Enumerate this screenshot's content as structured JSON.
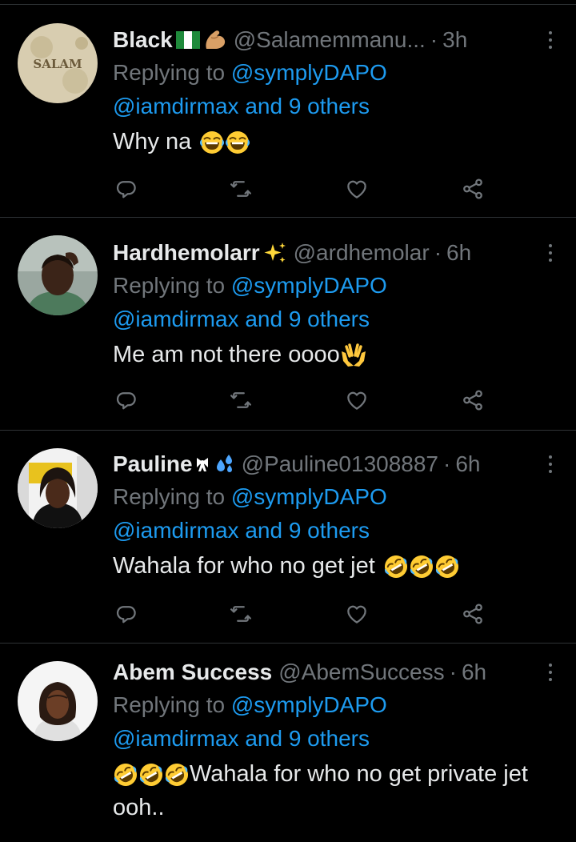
{
  "icons": {
    "more": "more-vertical-icon",
    "reply": "reply-icon",
    "retweet": "retweet-icon",
    "like": "heart-icon",
    "share": "share-icon"
  },
  "colors": {
    "background": "#000000",
    "text": "#e7e9ea",
    "muted": "#71767b",
    "link": "#1d9bf0",
    "divider": "#2f3336"
  },
  "tweets": [
    {
      "name": "Black",
      "handle": "@Salamemmanu...",
      "dot": "·",
      "time": "3h",
      "replying_label": "Replying to",
      "reply_user": "@symplyDAPO",
      "reply_others": "@iamdirmax and 9 others",
      "text": "Why na",
      "avatar_text": "SALAM"
    },
    {
      "name": "Hardhemolarr",
      "handle": "@ardhemolar",
      "dot": "·",
      "time": "6h",
      "replying_label": "Replying to",
      "reply_user": "@symplyDAPO",
      "reply_others": "@iamdirmax and 9 others",
      "text": "Me am not there oooo"
    },
    {
      "name": "Pauline",
      "handle": "@Pauline01308887",
      "dot": "·",
      "time": "6h",
      "replying_label": "Replying to",
      "reply_user": "@symplyDAPO",
      "reply_others": "@iamdirmax and 9 others",
      "text": "Wahala for who no get jet"
    },
    {
      "name": "Abem Success",
      "handle": "@AbemSuccess",
      "dot": "·",
      "time": "6h",
      "replying_label": "Replying to",
      "reply_user": "@symplyDAPO",
      "reply_others": "@iamdirmax and 9 others",
      "text": "Wahala for who no get private jet ooh.."
    }
  ]
}
